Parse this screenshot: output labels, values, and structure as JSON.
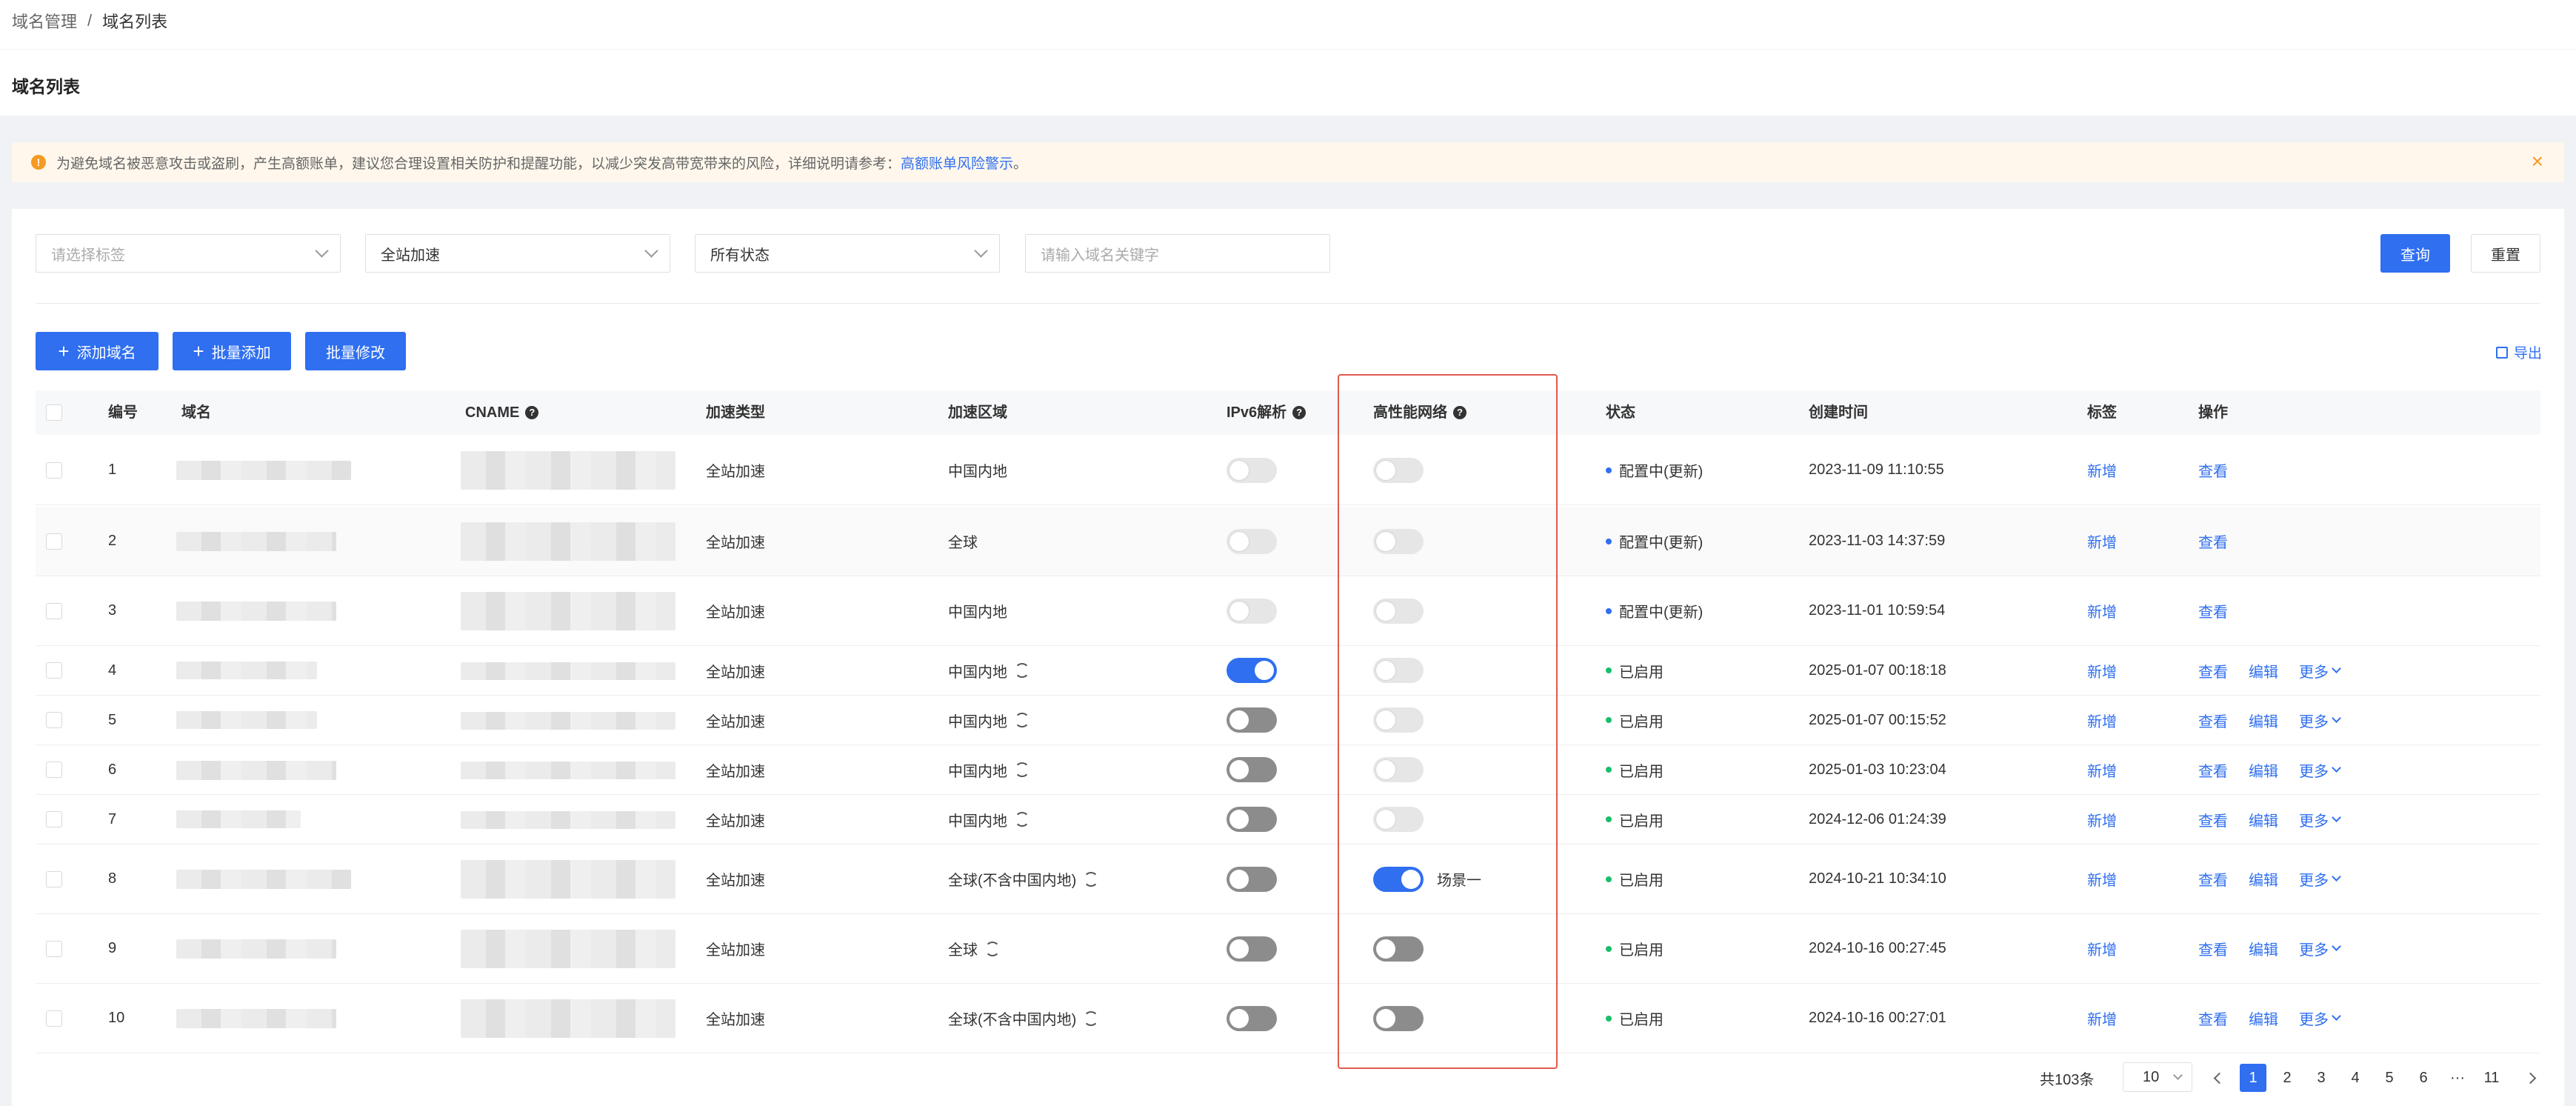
{
  "breadcrumb": {
    "parent": "域名管理",
    "sep": "/",
    "current": "域名列表"
  },
  "page_title": "域名列表",
  "alert": {
    "text": "为避免域名被恶意攻击或盗刷，产生高额账单，建议您合理设置相关防护和提醒功能，以减少突发高带宽带来的风险，详细说明请参考：",
    "link": "高额账单风险警示",
    "tail": "。"
  },
  "filters": {
    "tag_placeholder": "请选择标签",
    "accel_type": "全站加速",
    "status": "所有状态",
    "keyword_placeholder": "请输入域名关键字",
    "query_label": "查询",
    "reset_label": "重置"
  },
  "toolbar": {
    "add_domain": "添加域名",
    "batch_add": "批量添加",
    "batch_edit": "批量修改",
    "export": "导出"
  },
  "columns": {
    "no": "编号",
    "domain": "域名",
    "cname": "CNAME",
    "accel_type": "加速类型",
    "accel_region": "加速区域",
    "ipv6": "IPv6解析",
    "hpn": "高性能网络",
    "status": "状态",
    "created": "创建时间",
    "tag": "标签",
    "ops": "操作"
  },
  "actions": {
    "tag_add": "新增",
    "view": "查看",
    "edit": "编辑",
    "more": "更多"
  },
  "status_colors": {
    "configuring": "#2f6ff0",
    "enabled": "#19be6b"
  },
  "rows": [
    {
      "no": "1",
      "type": "全站加速",
      "region": "中国内地",
      "refresh": false,
      "ipv6": "off-light",
      "hpn": "off-light",
      "hpn_label": "",
      "status": "配置中(更新)",
      "status_kind": "configuring",
      "created": "2023-11-09 11:10:55"
    },
    {
      "no": "2",
      "type": "全站加速",
      "region": "全球",
      "refresh": false,
      "ipv6": "off-light",
      "hpn": "off-light",
      "hpn_label": "",
      "status": "配置中(更新)",
      "status_kind": "configuring",
      "created": "2023-11-03 14:37:59"
    },
    {
      "no": "3",
      "type": "全站加速",
      "region": "中国内地",
      "refresh": false,
      "ipv6": "off-light",
      "hpn": "off-light",
      "hpn_label": "",
      "status": "配置中(更新)",
      "status_kind": "configuring",
      "created": "2023-11-01 10:59:54"
    },
    {
      "no": "4",
      "type": "全站加速",
      "region": "中国内地",
      "refresh": true,
      "ipv6": "on",
      "hpn": "off-light",
      "hpn_label": "",
      "status": "已启用",
      "status_kind": "enabled",
      "created": "2025-01-07 00:18:18"
    },
    {
      "no": "5",
      "type": "全站加速",
      "region": "中国内地",
      "refresh": true,
      "ipv6": "off-dark",
      "hpn": "off-light",
      "hpn_label": "",
      "status": "已启用",
      "status_kind": "enabled",
      "created": "2025-01-07 00:15:52"
    },
    {
      "no": "6",
      "type": "全站加速",
      "region": "中国内地",
      "refresh": true,
      "ipv6": "off-dark",
      "hpn": "off-light",
      "hpn_label": "",
      "status": "已启用",
      "status_kind": "enabled",
      "created": "2025-01-03 10:23:04"
    },
    {
      "no": "7",
      "type": "全站加速",
      "region": "中国内地",
      "refresh": true,
      "ipv6": "off-dark",
      "hpn": "off-light",
      "hpn_label": "",
      "status": "已启用",
      "status_kind": "enabled",
      "created": "2024-12-06 01:24:39"
    },
    {
      "no": "8",
      "type": "全站加速",
      "region": "全球(不含中国内地)",
      "refresh": true,
      "ipv6": "off-dark",
      "hpn": "on",
      "hpn_label": "场景一",
      "status": "已启用",
      "status_kind": "enabled",
      "created": "2024-10-21 10:34:10"
    },
    {
      "no": "9",
      "type": "全站加速",
      "region": "全球",
      "refresh": true,
      "ipv6": "off-dark",
      "hpn": "off-dark",
      "hpn_label": "",
      "status": "已启用",
      "status_kind": "enabled",
      "created": "2024-10-16 00:27:45"
    },
    {
      "no": "10",
      "type": "全站加速",
      "region": "全球(不含中国内地)",
      "refresh": true,
      "ipv6": "off-dark",
      "hpn": "off-dark",
      "hpn_label": "",
      "status": "已启用",
      "status_kind": "enabled",
      "created": "2024-10-16 00:27:01"
    }
  ],
  "pagination": {
    "total": "共103条",
    "page_size": "10",
    "pages": [
      "1",
      "2",
      "3",
      "4",
      "5",
      "6"
    ],
    "ellipsis": "···",
    "last": "11",
    "current": "1"
  }
}
